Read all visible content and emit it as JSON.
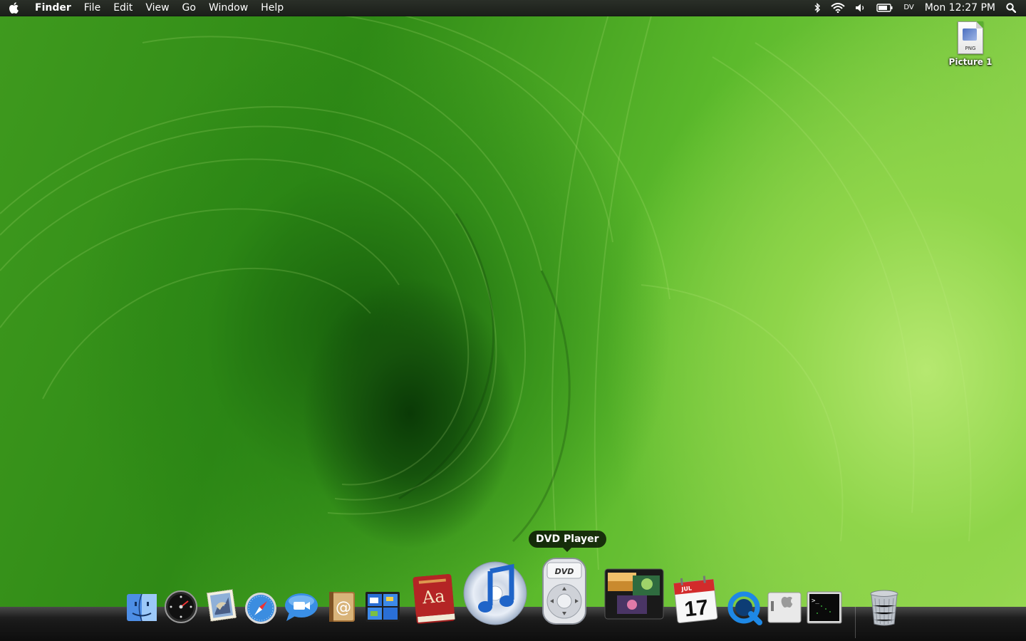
{
  "menubar": {
    "app_name": "Finder",
    "menus": [
      "File",
      "Edit",
      "View",
      "Go",
      "Window",
      "Help"
    ],
    "status_icons": [
      "bluetooth-icon",
      "wifi-icon",
      "volume-icon",
      "battery-icon"
    ],
    "dv_label": "DV",
    "clock": "Mon 12:27 PM",
    "spotlight_icon": "magnifier-icon"
  },
  "desktop": {
    "files": [
      {
        "name": "Picture 1",
        "type_label": "PNG"
      }
    ]
  },
  "dock": {
    "tooltip": "DVD Player",
    "items": [
      {
        "id": "finder",
        "icon": "finder-icon"
      },
      {
        "id": "dashboard",
        "icon": "dashboard-icon"
      },
      {
        "id": "mail",
        "icon": "mail-icon"
      },
      {
        "id": "safari",
        "icon": "safari-icon"
      },
      {
        "id": "ichat",
        "icon": "ichat-icon"
      },
      {
        "id": "address-book",
        "icon": "address-book-icon"
      },
      {
        "id": "spaces",
        "icon": "spaces-icon"
      },
      {
        "id": "dictionary",
        "icon": "dictionary-icon",
        "label": "Aa"
      },
      {
        "id": "itunes",
        "icon": "itunes-icon"
      },
      {
        "id": "dvd-player",
        "icon": "dvd-player-icon",
        "label": "DVD"
      },
      {
        "id": "photo-booth",
        "icon": "photo-viewer-icon"
      },
      {
        "id": "ical",
        "icon": "ical-icon",
        "month": "JUL",
        "day": "17"
      },
      {
        "id": "quicktime",
        "icon": "quicktime-icon"
      },
      {
        "id": "boot-camp",
        "icon": "boot-camp-icon"
      },
      {
        "id": "terminal",
        "icon": "terminal-icon",
        "label": ">_"
      },
      {
        "id": "trash",
        "icon": "trash-icon"
      }
    ]
  },
  "colors": {
    "menubar": "#1f231e",
    "wallpaper_green": "#3f9a1e",
    "wallpaper_light": "#b6e870"
  }
}
